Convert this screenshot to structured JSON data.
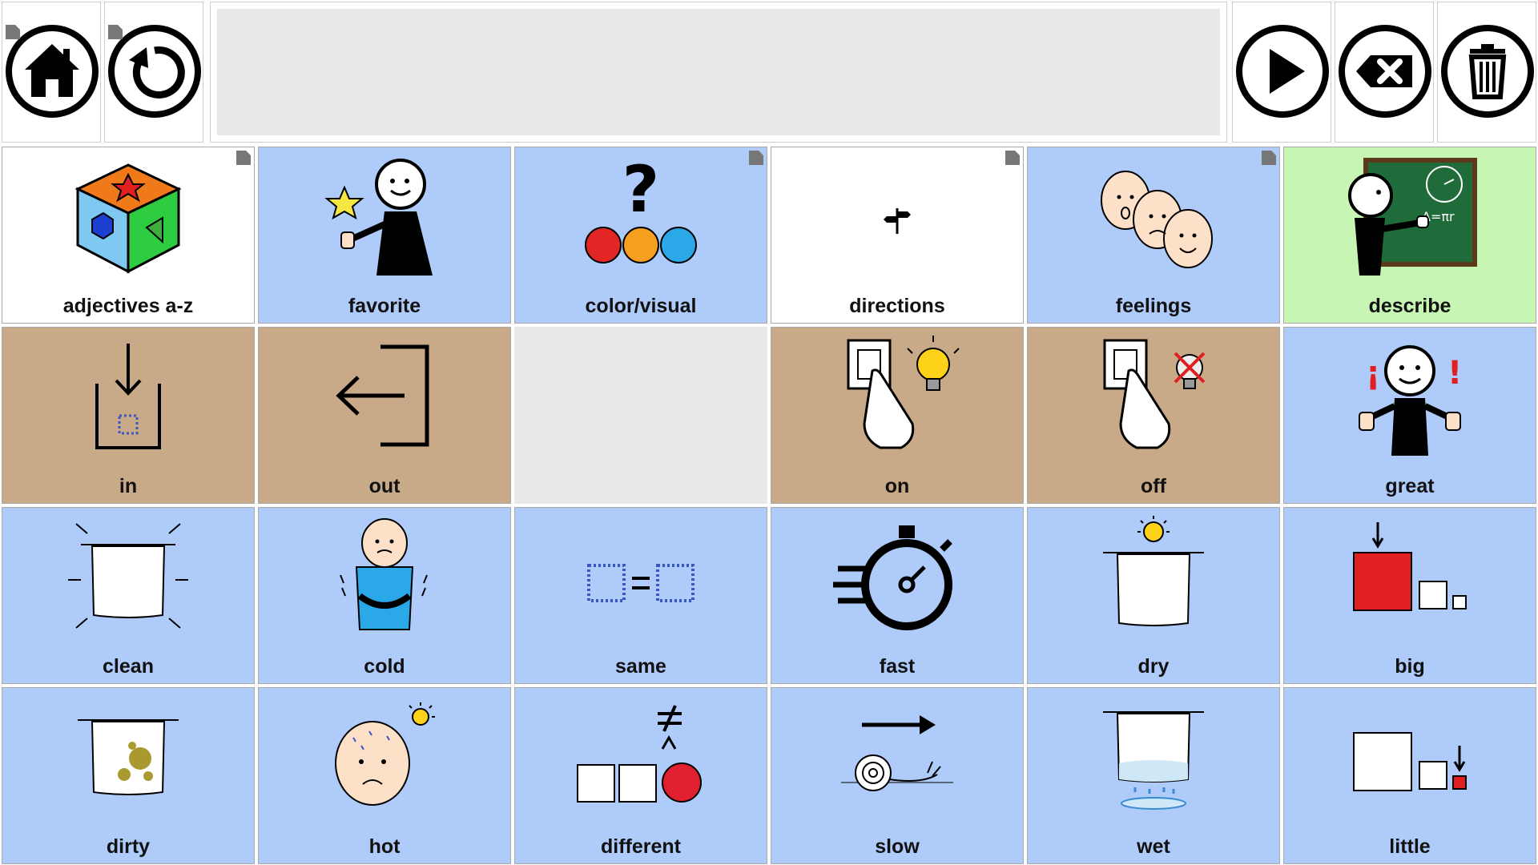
{
  "toolbar": {
    "home_icon": "home-icon",
    "back_icon": "undo-icon",
    "speak_icon": "play-icon",
    "backspace_icon": "backspace-icon",
    "clear_icon": "trash-icon",
    "message_text": ""
  },
  "colors": {
    "blue_cell": "#aecbfa",
    "tan_cell": "#c9aa88",
    "green_cell": "#c7f5b3",
    "white_cell": "#ffffff",
    "empty_cell": "#e8e8e8"
  },
  "cells": [
    {
      "label": "adjectives a-z",
      "color": "white",
      "folder": true,
      "icon": "shape-cube-icon"
    },
    {
      "label": "favorite",
      "color": "blue",
      "folder": false,
      "icon": "favorite-person-icon"
    },
    {
      "label": "color/visual",
      "color": "blue",
      "folder": true,
      "icon": "color-question-icon"
    },
    {
      "label": "directions",
      "color": "white",
      "folder": true,
      "icon": "signpost-icon"
    },
    {
      "label": "feelings",
      "color": "blue",
      "folder": true,
      "icon": "faces-icon"
    },
    {
      "label": "describe",
      "color": "green",
      "folder": false,
      "icon": "teacher-board-icon"
    },
    {
      "label": "in",
      "color": "tan",
      "folder": false,
      "icon": "in-arrow-icon"
    },
    {
      "label": "out",
      "color": "tan",
      "folder": false,
      "icon": "exit-arrow-icon"
    },
    {
      "label": "",
      "color": "empty",
      "folder": false,
      "icon": ""
    },
    {
      "label": "on",
      "color": "tan",
      "folder": false,
      "icon": "switch-on-icon"
    },
    {
      "label": "off",
      "color": "tan",
      "folder": false,
      "icon": "switch-off-icon"
    },
    {
      "label": "great",
      "color": "blue",
      "folder": false,
      "icon": "thumbs-up-person-icon"
    },
    {
      "label": "clean",
      "color": "blue",
      "folder": false,
      "icon": "clean-cloth-icon"
    },
    {
      "label": "cold",
      "color": "blue",
      "folder": false,
      "icon": "cold-person-icon"
    },
    {
      "label": "same",
      "color": "blue",
      "folder": false,
      "icon": "equal-squares-icon"
    },
    {
      "label": "fast",
      "color": "blue",
      "folder": false,
      "icon": "stopwatch-icon"
    },
    {
      "label": "dry",
      "color": "blue",
      "folder": false,
      "icon": "dry-cloth-icon"
    },
    {
      "label": "big",
      "color": "blue",
      "folder": false,
      "icon": "big-square-icon"
    },
    {
      "label": "dirty",
      "color": "blue",
      "folder": false,
      "icon": "dirty-cloth-icon"
    },
    {
      "label": "hot",
      "color": "blue",
      "folder": false,
      "icon": "hot-face-icon"
    },
    {
      "label": "different",
      "color": "blue",
      "folder": false,
      "icon": "not-equal-icon"
    },
    {
      "label": "slow",
      "color": "blue",
      "folder": false,
      "icon": "snail-icon"
    },
    {
      "label": "wet",
      "color": "blue",
      "folder": false,
      "icon": "wet-cloth-icon"
    },
    {
      "label": "little",
      "color": "blue",
      "folder": false,
      "icon": "little-square-icon"
    }
  ]
}
